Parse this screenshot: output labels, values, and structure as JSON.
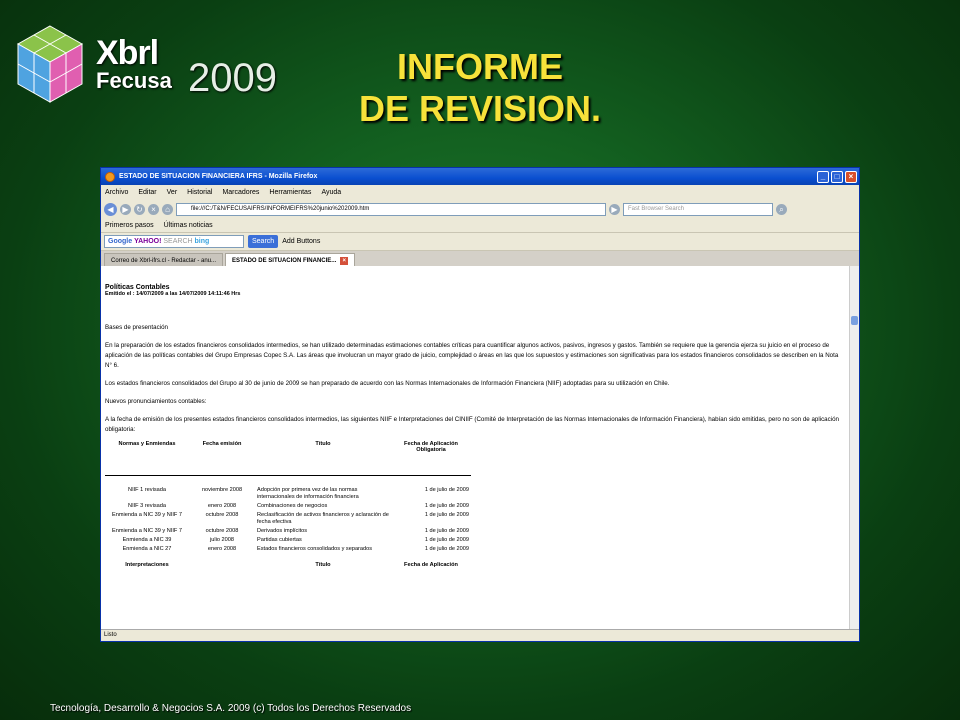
{
  "logo": {
    "word1": "Xbrl",
    "word2": "Fecusa",
    "year": "2009"
  },
  "slide_title": {
    "line1": "INFORME",
    "line2": "DE REVISION."
  },
  "browser": {
    "window_title": "ESTADO DE SITUACION FINANCIERA IFRS - Mozilla Firefox",
    "menu": [
      "Archivo",
      "Editar",
      "Ver",
      "Historial",
      "Marcadores",
      "Herramientas",
      "Ayuda"
    ],
    "address": "file:///C:/T&N/FECUSAIFRS/INFORMEIFRS%20junio%202009.htm",
    "search_placeholder": "Fast Browser Search",
    "bookmarks": [
      "Primeros pasos",
      "Últimas noticias"
    ],
    "google_toolbar": {
      "search_label": "Search",
      "add_buttons_label": "Add Buttons"
    },
    "tabs": [
      "Correo de Xbrl-ifrs.cl - Redactar - anu...",
      "ESTADO DE SITUACION FINANCIE..."
    ],
    "status": "Listo"
  },
  "document": {
    "heading": "Políticas Contables",
    "issued": "Emitido el : 14/07/2009 a las 14/07/2009 14:11:46 Hrs",
    "section1_title": "Bases de presentación",
    "p1": "En la preparación de los estados financieros consolidados intermedios, se han utilizado determinadas estimaciones contables críticas para cuantificar algunos activos, pasivos, ingresos y gastos. También se requiere que la gerencia ejerza su juicio en el proceso de aplicación de las políticas contables del Grupo Empresas Copec S.A. Las áreas que involucran un mayor grado de juicio, complejidad o áreas en las que los supuestos y estimaciones son significativas para los estados financieros consolidados se describen en la Nota N° 6.",
    "p2": "Los estados financieros consolidados del Grupo al 30 de junio de 2009 se han preparado de acuerdo con las Normas Internacionales de Información Financiera (NIIF) adoptadas para su utilización en Chile.",
    "section2_title": "Nuevos pronunciamientos contables:",
    "p3": "A la fecha de emisión de los presentes estados financieros consolidados intermedios, las siguientes NIIF e Interpretaciones del CINIIF (Comité de Interpretación de las Normas Internacionales de Información Financiera), habían sido emitidas, pero no son de aplicación obligatoria:",
    "table_headers": [
      "Normas y Enmiendas",
      "Fecha emisión",
      "Título",
      "Fecha de Aplicación Obligatoria"
    ],
    "rows": [
      [
        "NIIF 1 revisada",
        "noviembre 2008",
        "Adopción por primera vez de las normas internacionales de información financiera",
        "1 de julio de 2009"
      ],
      [
        "NIIF 3 revisada",
        "enero 2008",
        "Combinaciones de negocios",
        "1 de julio de 2009"
      ],
      [
        "Enmienda a NIC 39 y NIIF 7",
        "octubre 2008",
        "Reclasificación de activos financieros y aclaración de fecha efectiva",
        "1 de julio de 2009"
      ],
      [
        "Enmienda a NIC 39 y NIIF 7",
        "octubre 2008",
        "Derivados implícitos",
        "1 de julio de 2009"
      ],
      [
        "Enmienda a NIC 39",
        "julio 2008",
        "Partidas cubiertas",
        "1 de julio de 2009"
      ],
      [
        "Enmienda a NIC 27",
        "enero 2008",
        "Estados financieros consolidados y separados",
        "1 de julio de 2009"
      ]
    ],
    "table2_headers": [
      "Interpretaciones",
      "Título",
      "Fecha de Aplicación"
    ]
  },
  "footer": "Tecnología, Desarrollo & Negocios S.A. 2009 (c) Todos los Derechos Reservados",
  "colors": {
    "title": "#f7e23a",
    "background": "#136020",
    "titlebar": "#0a4fd0"
  }
}
